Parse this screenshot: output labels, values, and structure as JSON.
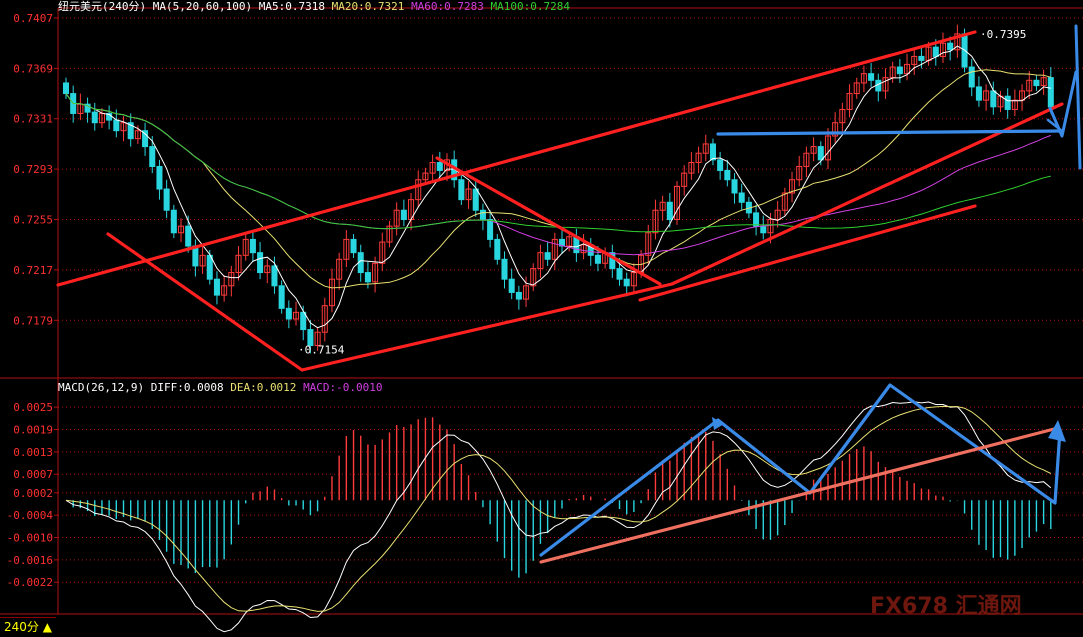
{
  "header": {
    "main_title": "纽元美元(240分)",
    "ma_params": "MA(5,20,60,100)",
    "ma5": "MA5:0.7318",
    "ma20": "MA20:0.7321",
    "ma60": "MA60:0.7283",
    "ma100": "MA100:0.7284"
  },
  "macd_header": {
    "params": "MACD(26,12,9)",
    "diff": "DIFF:0.0008",
    "dea": "DEA:0.0012",
    "macd": "MACD:-0.0010"
  },
  "footer": {
    "period_tab": "240分",
    "watermark": "FX678 汇通网"
  },
  "colors": {
    "up": "#ff3b3b",
    "down": "#29d6e0",
    "ma5": "#ffffff",
    "ma20": "#e8e070",
    "ma60": "#d040e0",
    "ma100": "#30d030",
    "trend_red": "#ff2020",
    "trend_blue": "#3a8ae8",
    "trend_salmon": "#f07060",
    "axis": "#b01010"
  },
  "chart_data": [
    {
      "type": "candlestick",
      "title": "纽元美元(240分)",
      "ylim": [
        0.714,
        0.741
      ],
      "y_ticks": [
        0.7407,
        0.7369,
        0.7331,
        0.7293,
        0.7255,
        0.7217,
        0.7179
      ],
      "y_tick_labels": [
        "0.7407",
        "0.7369",
        "0.7331",
        "0.7293",
        "0.7255",
        "0.7217",
        "0.7179"
      ],
      "annotations": [
        {
          "text": "0.7395",
          "value": 0.7395
        },
        {
          "text": "0.7154",
          "value": 0.7154
        }
      ],
      "close": [
        0.735,
        0.7335,
        0.7342,
        0.7336,
        0.7328,
        0.7335,
        0.733,
        0.7322,
        0.7328,
        0.7316,
        0.7322,
        0.731,
        0.7295,
        0.7278,
        0.7262,
        0.7245,
        0.725,
        0.7235,
        0.722,
        0.7228,
        0.721,
        0.7198,
        0.7205,
        0.7215,
        0.7228,
        0.724,
        0.723,
        0.7215,
        0.722,
        0.7205,
        0.7188,
        0.718,
        0.7185,
        0.7172,
        0.716,
        0.717,
        0.719,
        0.721,
        0.7225,
        0.724,
        0.723,
        0.7215,
        0.7208,
        0.7222,
        0.7238,
        0.725,
        0.7262,
        0.7255,
        0.727,
        0.7285,
        0.729,
        0.7298,
        0.7292,
        0.73,
        0.7285,
        0.727,
        0.7278,
        0.7262,
        0.7255,
        0.724,
        0.7225,
        0.721,
        0.72,
        0.7195,
        0.7205,
        0.7218,
        0.723,
        0.7225,
        0.724,
        0.7235,
        0.7242,
        0.723,
        0.7236,
        0.7228,
        0.7222,
        0.723,
        0.7218,
        0.721,
        0.7205,
        0.7215,
        0.7228,
        0.7245,
        0.7262,
        0.7268,
        0.7255,
        0.728,
        0.729,
        0.7298,
        0.7305,
        0.7312,
        0.73,
        0.7292,
        0.7285,
        0.7275,
        0.7268,
        0.726,
        0.725,
        0.7245,
        0.7255,
        0.7262,
        0.7275,
        0.7285,
        0.7295,
        0.7305,
        0.731,
        0.73,
        0.7318,
        0.7328,
        0.7338,
        0.735,
        0.7358,
        0.7365,
        0.736,
        0.7352,
        0.7362,
        0.737,
        0.7365,
        0.7372,
        0.7378,
        0.7375,
        0.7385,
        0.7378,
        0.7388,
        0.7383,
        0.7395,
        0.737,
        0.7355,
        0.7345,
        0.7352,
        0.734,
        0.7348,
        0.7338,
        0.7345,
        0.7352,
        0.736,
        0.7356,
        0.7362,
        0.734
      ]
    },
    {
      "type": "histogram",
      "title": "MACD(26,12,9)",
      "ylim": [
        -0.003,
        0.0028
      ],
      "y_ticks": [
        0.0025,
        0.0019,
        0.0013,
        0.0007,
        0.0002,
        -0.0004,
        -0.001,
        -0.0016,
        -0.0022
      ],
      "y_tick_labels": [
        "0.0025",
        "0.0019",
        "0.0013",
        "0.0007",
        "0.0002",
        "-0.0004",
        "-0.0010",
        "-0.0016",
        "-0.0022"
      ],
      "series_labels": [
        "DIFF",
        "DEA",
        "MACD"
      ]
    }
  ]
}
